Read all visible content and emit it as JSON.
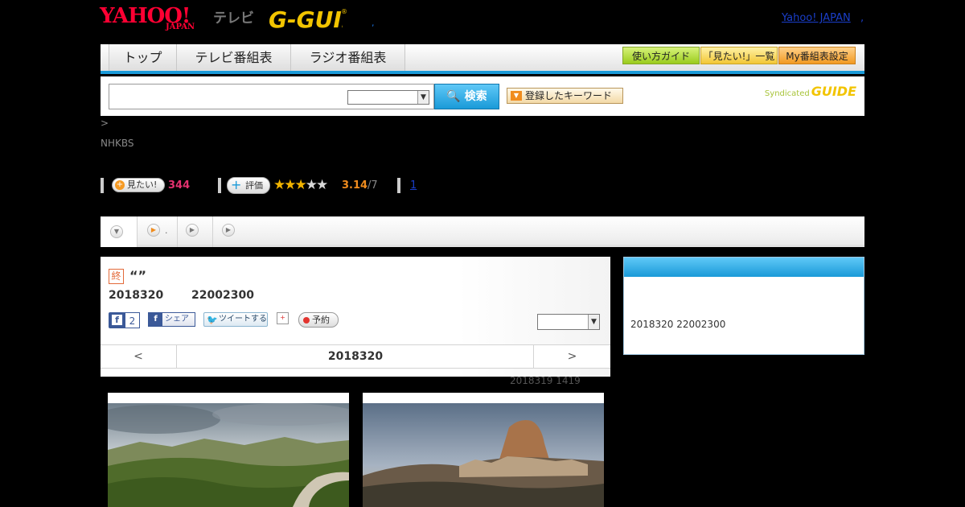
{
  "header": {
    "yahoo_logo": "YAHOO!",
    "yahoo_japan_sub": "JAPAN",
    "tv_label": "テレビ",
    "gguide_logo": "G-GUIDE",
    "dot": ",",
    "yahoo_japan_link": "Yahoo! JAPAN",
    "link_sep": ","
  },
  "nav": {
    "tabs": [
      "トップ",
      "テレビ番組表",
      "ラジオ番組表"
    ],
    "buttons": [
      "使い方ガイド",
      "「見たい!」一覧",
      "My番組表設定"
    ]
  },
  "search": {
    "value": "",
    "button_label": "🔍 検索",
    "keyword_button": "登録したキーワード",
    "syndicated": "Syndicated",
    "syndicated_logo": "GUIDE"
  },
  "breadcrumb": ">",
  "channel": "NHKBS",
  "stats": {
    "mitai_label": "見たい!",
    "mitai_count": "344",
    "hyoka_label": "評価",
    "stars_filled": 3,
    "stars_total": 5,
    "rating": "3.14",
    "rating_count": "/7",
    "link_one": "1"
  },
  "tabs": {
    "tab2_label": "."
  },
  "program": {
    "end_badge": "終",
    "title": "“”",
    "date": "2018320",
    "time": "22002300",
    "fb_like_count": "2",
    "fb_share": "シェア",
    "tweet": "ツイートする",
    "reserve": "予約",
    "select_value": ""
  },
  "datenav": {
    "prev": "<",
    "date": "2018320",
    "next": ">"
  },
  "updated": "2018319  1419",
  "side": {
    "header": "",
    "text": "2018320  22002300"
  }
}
